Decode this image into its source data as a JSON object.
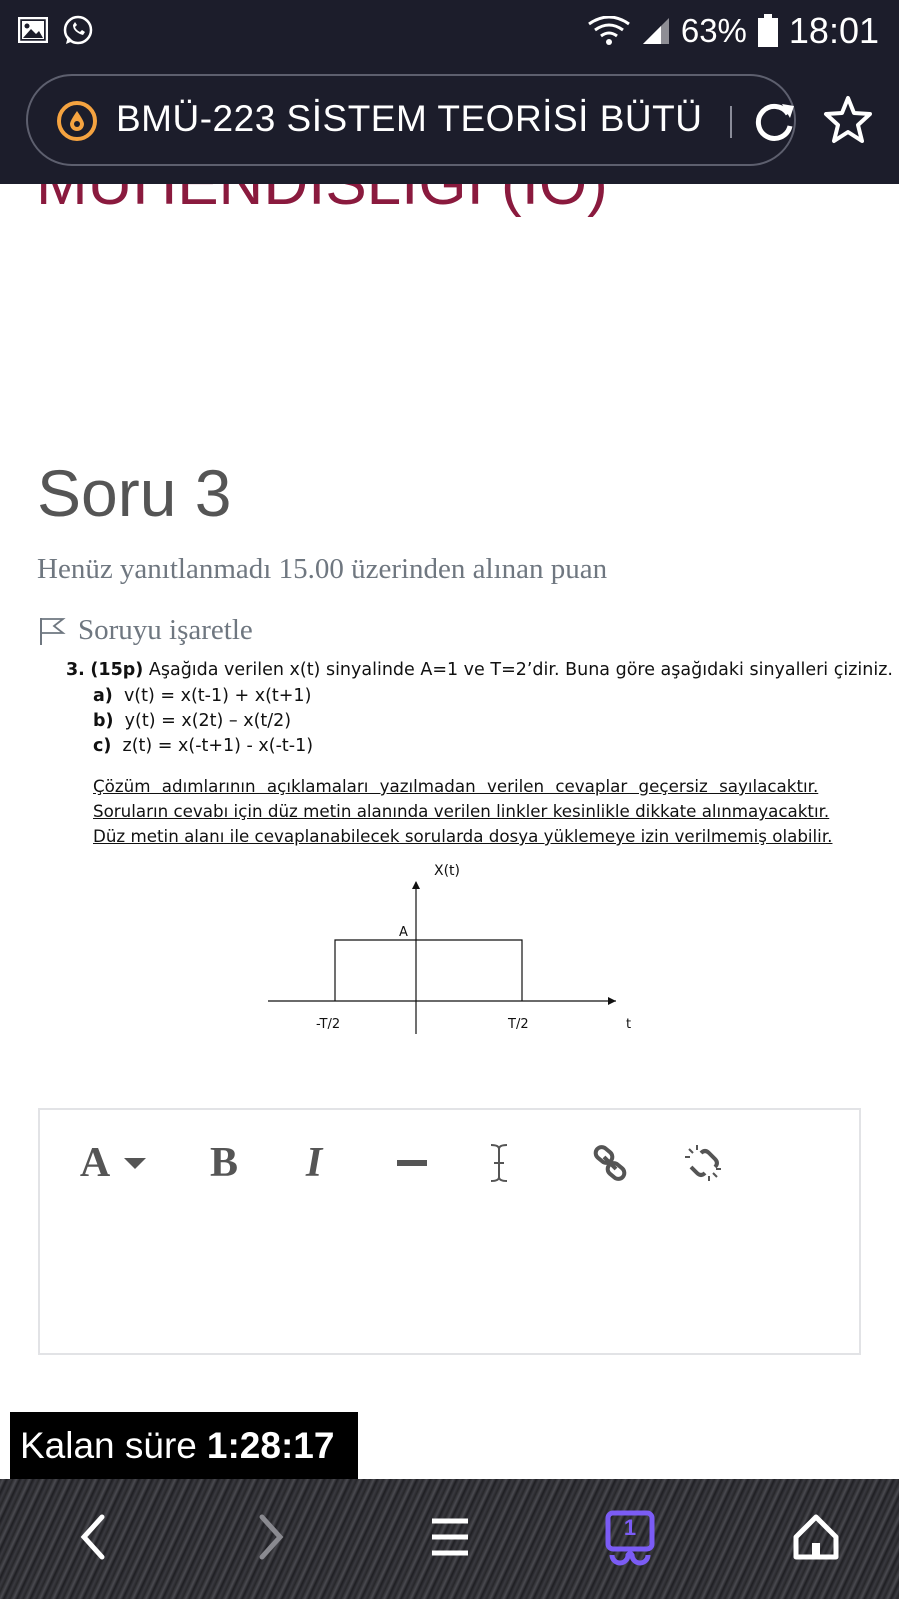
{
  "status_bar": {
    "battery": "63%",
    "time": "18:01"
  },
  "browser": {
    "url_title": "BMÜ-223 SİSTEM TEORİSİ BÜTÜ"
  },
  "course_title_fragment": "MÜHENDİSLİĞİ (İÖ)",
  "question": {
    "title": "Soru 3",
    "status": "Henüz yanıtlanmadı  15.00 üzerinden alınan puan",
    "flag_label": "Soruyu işaretle",
    "number": "3.",
    "points": "(15p)",
    "prompt": "Aşağıda verilen x(t) sinyalinde A=1 ve T=2’dir. Buna göre aşağıdaki sinyalleri çiziniz.",
    "items": [
      {
        "label": "a)",
        "text": "v(t) = x(t-1) + x(t+1)"
      },
      {
        "label": "b)",
        "text": "y(t) = x(2t) – x(t/2)"
      },
      {
        "label": "c)",
        "text": "z(t) = x(-t+1) - x(-t-1)"
      }
    ],
    "notes": [
      "Çözüm adımlarının açıklamaları yazılmadan verilen cevaplar geçersiz sayılacaktır.",
      "Soruların cevabı için düz metin alanında verilen linkler kesinlikle dikkate alınmayacaktır.",
      "Düz metin alanı ile cevaplanabilecek sorularda dosya yüklemeye izin verilmemiş olabilir."
    ],
    "graph": {
      "y_label": "X(t)",
      "amplitude_label": "A",
      "left_tick": "-T/2",
      "right_tick": "T/2",
      "x_label": "t"
    }
  },
  "editor": {
    "font_button": "A",
    "bold_button": "B",
    "italic_button": "I"
  },
  "timer": {
    "label": "Kalan süre",
    "value": "1:28:17"
  },
  "nav": {
    "tab_count": "1"
  },
  "icons": [
    "gallery-icon",
    "whatsapp-icon",
    "wifi-icon",
    "signal-icon",
    "battery-icon",
    "site-icon",
    "reload-icon",
    "star-icon",
    "flag-icon",
    "hr-icon",
    "cursor-icon",
    "link-icon",
    "unlink-icon",
    "back-icon",
    "forward-icon",
    "menu-icon",
    "tabs-icon",
    "home-icon"
  ],
  "colors": {
    "system_bar": "#1c1d2b",
    "course_title": "#8a1a3e",
    "site_icon": "#f5a340",
    "tab_icon": "#7b5cf5"
  }
}
